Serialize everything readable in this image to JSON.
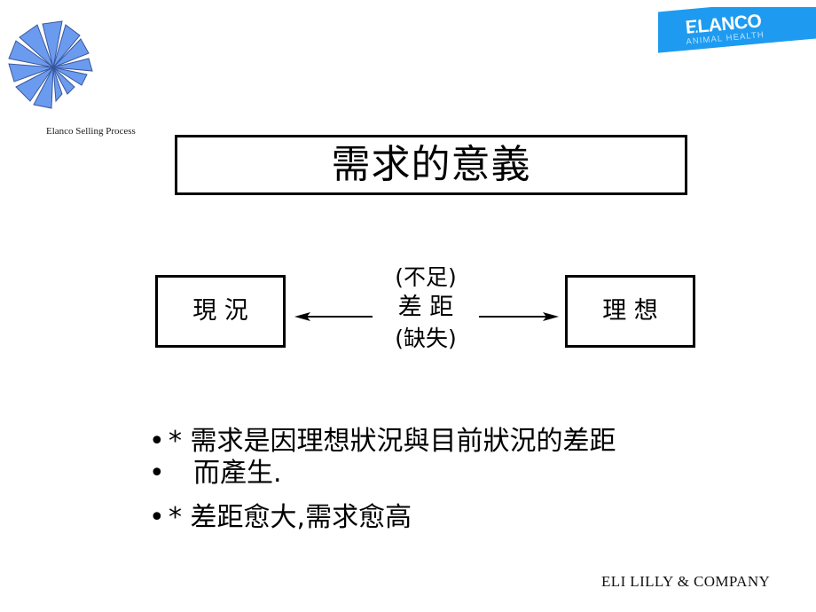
{
  "slide": {
    "background_color": "#ffffff",
    "title": "需求的意義",
    "footer_company": "ELI LILLY & COMPANY",
    "selling_process_caption": "Elanco Selling Process"
  },
  "brand": {
    "elanco_wordmark_before_l": "E",
    "elanco_wordmark_l": "L",
    "elanco_wordmark_after_l": "ANCO",
    "elanco_wordmark_full": "ELANCO",
    "elanco_tagline": "ANIMAL HEALTH",
    "banner_color": "#1e9bf0",
    "wordmark_color": "#ffffff",
    "tagline_color": "#bfe2fb",
    "banner_corner_marks": "..",
    "pinwheel_color": "#5a8fe0",
    "pinwheel_fill": "#6f9ff0",
    "pinwheel_outline": "#3c5fa8"
  },
  "diagram": {
    "left_box_label": "現 況",
    "right_box_label": "理 想",
    "center_top_label": "(不足)",
    "center_middle_label": "差 距",
    "center_bottom_label": "(缺失)",
    "left_arrow": "arrow-left",
    "right_arrow": "arrow-right",
    "line_color": "#000000"
  },
  "bullets": [
    {
      "marker": "•",
      "text": "* 需求是因理想狀況與目前狀況的差距"
    },
    {
      "marker": "•",
      "text": "而產生."
    },
    {
      "marker": "•",
      "text": "* 差距愈大,需求愈高"
    }
  ]
}
